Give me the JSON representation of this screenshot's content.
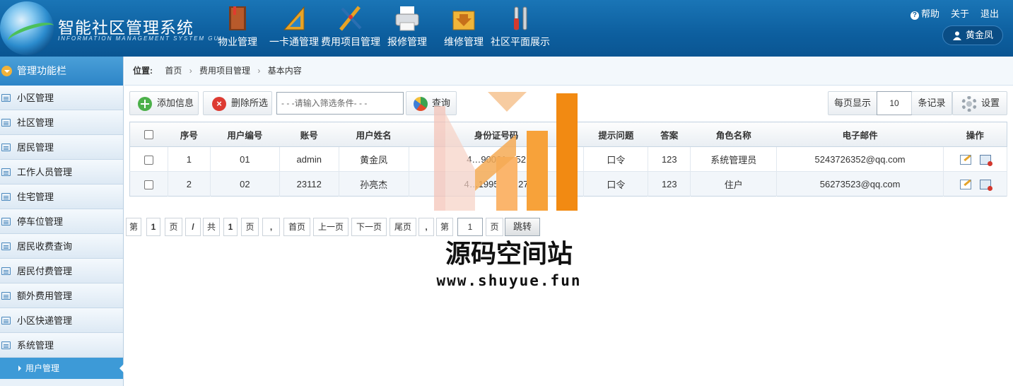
{
  "header": {
    "title": "智能社区管理系统",
    "subtitle": "INFORMATION MANAGEMENT SYSTEM GUI",
    "nav": [
      {
        "label": "物业管理",
        "icon": "book-icon"
      },
      {
        "label": "一卡通管理",
        "icon": "ruler-icon"
      },
      {
        "label": "费用项目管理",
        "icon": "drafting-tools-icon"
      },
      {
        "label": "报修管理",
        "icon": "printer-icon"
      },
      {
        "label": "维修管理",
        "icon": "download-box-icon"
      },
      {
        "label": "社区平面展示",
        "icon": "tools-icon"
      }
    ],
    "links": {
      "help": "帮助",
      "about": "关于",
      "logout": "退出"
    },
    "user": "黄金凤"
  },
  "sidebar": {
    "title": "管理功能栏",
    "items": [
      {
        "label": "小区管理"
      },
      {
        "label": "社区管理"
      },
      {
        "label": "居民管理"
      },
      {
        "label": "工作人员管理"
      },
      {
        "label": "住宅管理"
      },
      {
        "label": "停车位管理"
      },
      {
        "label": "居民收费查询"
      },
      {
        "label": "居民付费管理"
      },
      {
        "label": "额外费用管理"
      },
      {
        "label": "小区快递管理"
      },
      {
        "label": "系统管理"
      }
    ],
    "active_sub": "用户管理"
  },
  "breadcrumb": {
    "label": "位置:",
    "items": [
      "首页",
      "费用项目管理",
      "基本内容"
    ]
  },
  "toolbar": {
    "add": "添加信息",
    "delete": "删除所选",
    "filter_placeholder": "- - -请输入筛选条件- - -",
    "query": "查询",
    "per_page_label": "每页显示",
    "per_page_value": "10",
    "per_page_unit": "条记录",
    "settings": "设置"
  },
  "table": {
    "headers": [
      "序号",
      "用户编号",
      "账号",
      "用户姓名",
      "身份证号码",
      "提示问题",
      "答案",
      "角色名称",
      "电子邮件",
      "操作"
    ],
    "rows": [
      {
        "no": "1",
        "code": "01",
        "account": "admin",
        "name": "黄金凤",
        "id_card": "4…90061…52",
        "question": "口令",
        "answer": "123",
        "role": "系统管理员",
        "email": "5243726352@qq.com"
      },
      {
        "no": "2",
        "code": "02",
        "account": "23112",
        "name": "孙亮杰",
        "id_card": "4…199506…27",
        "question": "口令",
        "answer": "123",
        "role": "住户",
        "email": "56273523@qq.com"
      }
    ]
  },
  "pager": {
    "page_prefix": "第",
    "current": "1",
    "page_suffix": "页",
    "slash": "/",
    "total_prefix": "共",
    "total": "1",
    "total_suffix": "页",
    "comma": ",",
    "first": "首页",
    "prev": "上一页",
    "next": "下一页",
    "last": "尾页",
    "comma2": ",",
    "goto_prefix": "第",
    "goto_value": "1",
    "goto_suffix": "页",
    "go": "跳转"
  },
  "watermark": {
    "text": "源码空间站",
    "url": "www.shuyue.fun"
  },
  "colors": {
    "header": "#0d5f9f",
    "sidebar_active": "#3d9ad7",
    "watermark_orange": "#f39a1f"
  }
}
